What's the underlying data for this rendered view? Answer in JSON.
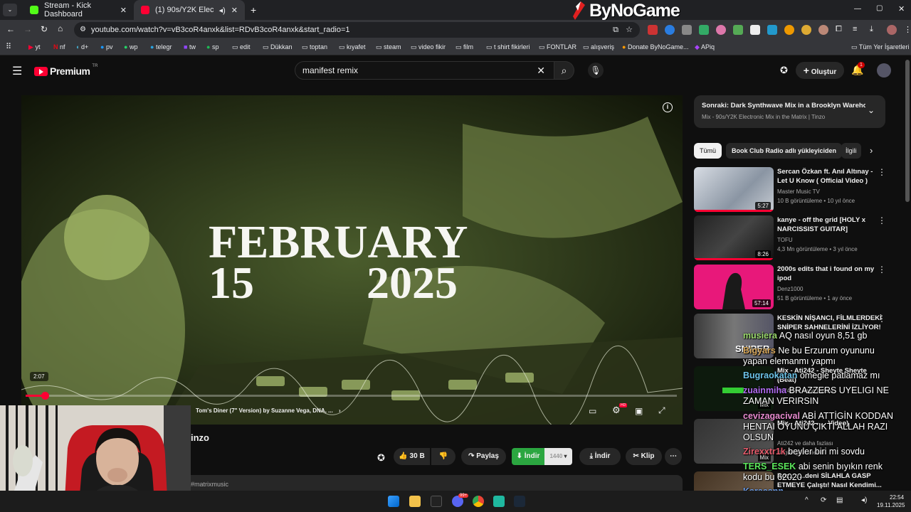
{
  "browser": {
    "tabs": [
      {
        "label": "Stream - Kick Dashboard"
      },
      {
        "label": "(1) 90s/Y2K Electronic Mix i"
      }
    ],
    "url": "youtube.com/watch?v=vB3coR4anxk&list=RDvB3coR4anxk&start_radio=1",
    "bookmarks": [
      "yt",
      "nf",
      "d+",
      "pv",
      "wp",
      "telegr",
      "tw",
      "sp",
      "edit",
      "Dükkan",
      "toptan",
      "kıyafet",
      "steam",
      "video fikir",
      "film",
      "t shirt fikirleri",
      "FONTLAR",
      "alışveriş",
      "Donate ByNoGame...",
      "APiq",
      "Tüm Yer İşaretleri"
    ],
    "overlay_logo": "ByNoGame"
  },
  "youtube": {
    "logo": "Premium",
    "logo_country": "TR",
    "search_value": "manifest remix",
    "create_label": "Oluştur",
    "notif_count": "1",
    "player": {
      "overlay_line1": "FEBRUARY",
      "overlay_line2a": "15",
      "overlay_line2b": "2025",
      "time_tooltip": "2:07",
      "chapter_text": "Tom's Diner (7\" Version) by Suzanne Vega, DNA, ...",
      "hd_badge": "HD",
      "progress": 0.03
    },
    "title_fragment": "inzo",
    "actions": {
      "like_count": "30 B",
      "share": "Paylaş",
      "download_ext": "İndir",
      "quality": "1440",
      "download": "İndir",
      "clip": "Klip"
    },
    "hashtag": "#matrixmusic",
    "next": {
      "title": "Sonraki: Dark Synthwave Mix in a Brooklyn Wareho...",
      "subtitle": "Mix - 90s/Y2K Electronic Mix in the Matrix | Tinzo"
    },
    "chips": [
      "Tümü",
      "Book Club Radio adlı yükleyiciden",
      "İlgili"
    ],
    "recommendations": [
      {
        "title": "Sercan Özkan ft. Anıl Altınay - Let U Know ( Official Video )",
        "channel": "Master Music TV",
        "meta": "10 B görüntüleme • 10 yıl önce",
        "duration": "5:27"
      },
      {
        "title": "kanye - off the grid [HOLY x NARCISSIST GUITAR]",
        "channel": "TOFU",
        "meta": "4,3 Mn görüntüleme • 3 yıl önce",
        "duration": "8:26"
      },
      {
        "title": "2000s edits that i found on my ipod",
        "channel": "Denz1000",
        "meta": "51 B görüntüleme • 1 ay önce",
        "duration": "57:14"
      },
      {
        "title": "KESKİN NİŞANCI, FİLMLERDEKİ SNİPER SAHNELERİNİ İZLİYOR!",
        "channel": "",
        "meta": "",
        "duration": ""
      },
      {
        "title": "Mix - Ati242 - Sheyte Sheyte (Beat)",
        "channel": "Ati242 ve daha fazlası",
        "meta": "",
        "duration": ""
      },
      {
        "title": "Mix - Ati242 - ... Video)",
        "channel": "Ati242 ve daha fazlası",
        "meta": "Bugün güncellendi",
        "duration": ""
      },
      {
        "title": "Boz...: ...deni SİLAHLA GASP ETMEYE Çalıştı! Nasıl Kendimi...",
        "channel": "",
        "meta": "",
        "duration": ""
      }
    ],
    "thumb_labels": {
      "mix": "Mix",
      "sniper": "SNIPER"
    }
  },
  "chat": [
    {
      "user": "musiera",
      "text": "AQ nasıl oyun 8,51 gb",
      "color": "#9ad86c"
    },
    {
      "user": "Bigyars",
      "text": "Ne bu Erzurum oyununu",
      "color": "#d8a85c"
    },
    {
      "user": "",
      "text": "yapan elemanmı yapmı",
      "color": "#ffffff"
    },
    {
      "user": "Bugraokatan",
      "text": "omegle patlamaz mı",
      "color": "#6cc3e8"
    },
    {
      "user": "zuainmiha",
      "text": "BRAZZERS UYELIGI NE",
      "color": "#b06cf0"
    },
    {
      "user": "",
      "text": "ZAMAN VERIRSIN",
      "color": "#ffffff"
    },
    {
      "user": "cevizagacival",
      "text": "ABİ ATTİGİN KODDAN",
      "color": "#e88bd0"
    },
    {
      "user": "",
      "text": "HENTAI OYUNU ÇIKTI ALLAH RAZI",
      "color": "#ffffff"
    },
    {
      "user": "",
      "text": "OLSUN",
      "color": "#ffffff"
    },
    {
      "user": "Zirexxtr1k",
      "text": "beyler biri mi sovdu",
      "color": "#e85c6c"
    },
    {
      "user": "TERS_ESEK",
      "text": "abi senin bıyıkın renk",
      "color": "#5ce85c"
    },
    {
      "user": "",
      "text": "kodu bu 62020",
      "color": "#ffffff"
    },
    {
      "user": "Karacann",
      "text": "",
      "color": "#6c9de8"
    }
  ],
  "taskbar": {
    "time": "22:54",
    "date": "19.11.2025",
    "badge": "99+"
  },
  "colors": {
    "accent_red": "#ff0033",
    "download_green": "#2ba640",
    "chat_bg": "#0f0f0f"
  }
}
